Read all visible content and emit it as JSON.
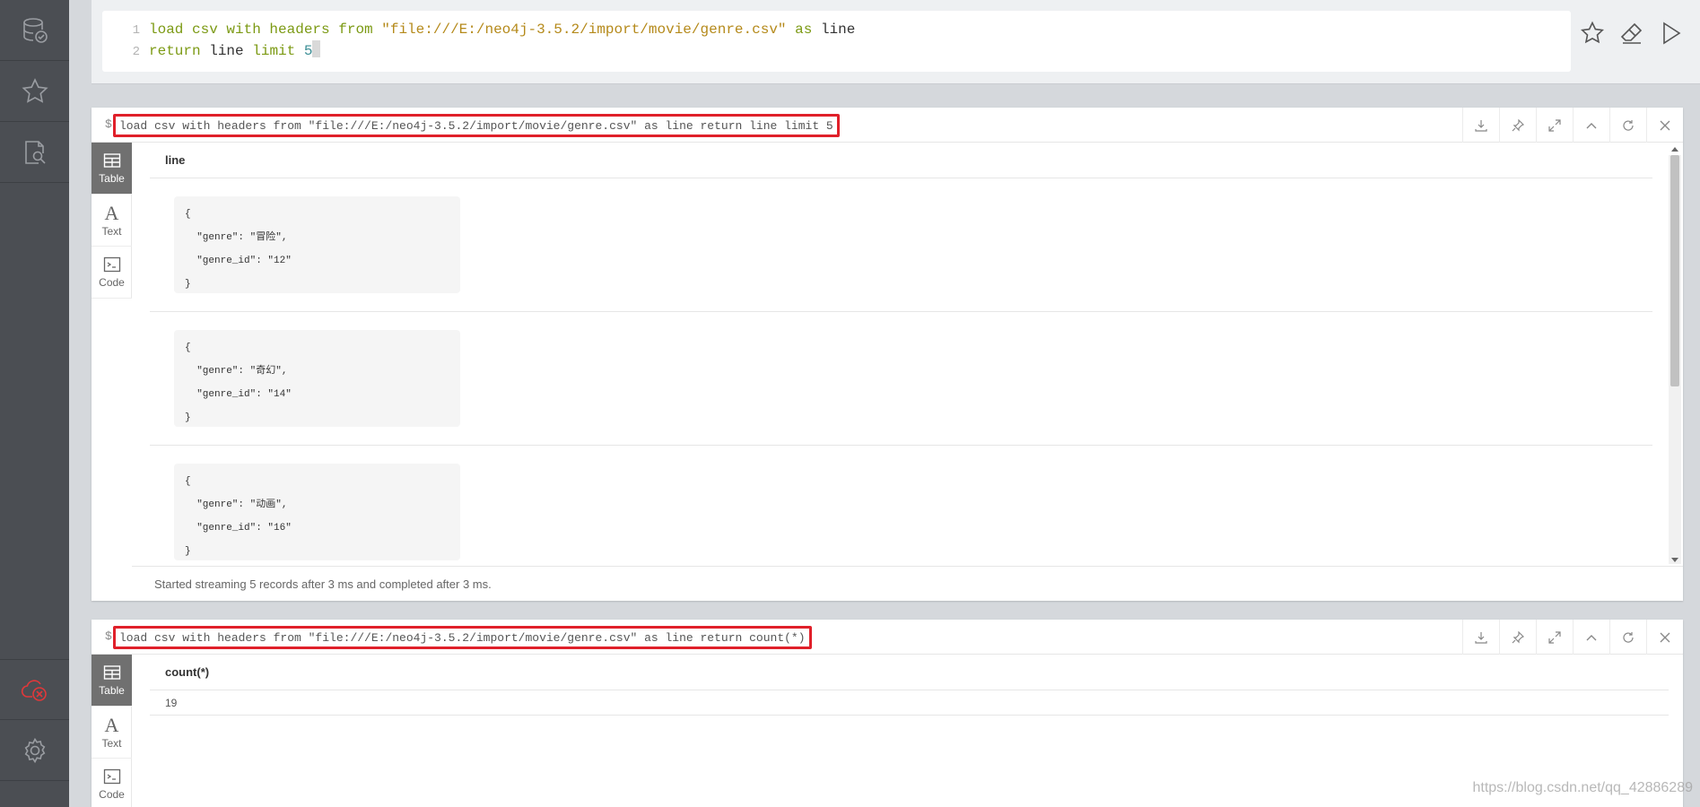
{
  "editor": {
    "lines": [
      {
        "number": "1",
        "tokens": {
          "t1": "load csv with headers from",
          "t2": "\"file:///E:/neo4j-3.5.2/import/movie/genre.csv\"",
          "t3": "as",
          "t4": "line"
        }
      },
      {
        "number": "2",
        "tokens": {
          "t1": "return",
          "t2": "line",
          "t3": "limit",
          "t4": "5"
        }
      }
    ]
  },
  "frames": [
    {
      "prompt": "$",
      "query": "load csv with headers from \"file:///E:/neo4j-3.5.2/import/movie/genre.csv\" as line return line limit 5",
      "tabs": [
        "Table",
        "Text",
        "Code"
      ],
      "column": "line",
      "rows": [
        [
          "{",
          "  \"genre\": \"冒险\",",
          "  \"genre_id\": \"12\"",
          "}"
        ],
        [
          "{",
          "  \"genre\": \"奇幻\",",
          "  \"genre_id\": \"14\"",
          "}"
        ],
        [
          "{",
          "  \"genre\": \"动画\",",
          "  \"genre_id\": \"16\"",
          "}"
        ]
      ],
      "status": "Started streaming 5 records after 3 ms and completed after 3 ms."
    },
    {
      "prompt": "$",
      "query": "load csv with headers from \"file:///E:/neo4j-3.5.2/import/movie/genre.csv\" as line return count(*)",
      "tabs": [
        "Table",
        "Text",
        "Code"
      ],
      "column": "count(*)",
      "value": "19"
    }
  ],
  "watermark": "https://blog.csdn.net/qq_42886289",
  "colors": {
    "sidebar": "#4b4e53",
    "keyword": "#7c9a14",
    "string": "#b58a1b",
    "highlight_box": "#e0202a",
    "disconnected": "#e0383a"
  },
  "icons": {
    "sidebar": [
      "database-icon",
      "star-icon",
      "document-search-icon",
      "cloud-disconnected-icon",
      "gear-icon",
      "help-icon"
    ],
    "editor": [
      "star-icon",
      "eraser-icon",
      "play-icon"
    ],
    "frame": [
      "download-icon",
      "pin-icon",
      "expand-icon",
      "collapse-icon",
      "rerun-icon",
      "close-icon"
    ]
  }
}
